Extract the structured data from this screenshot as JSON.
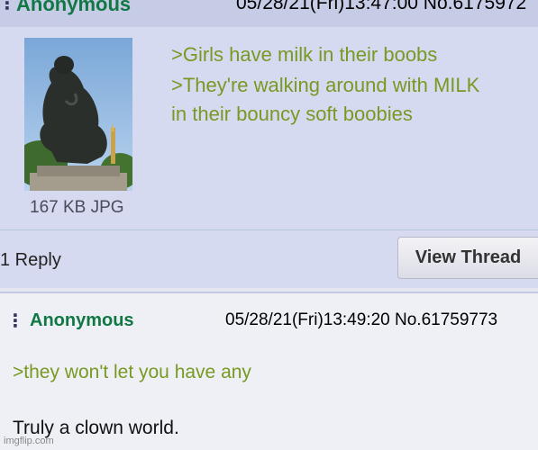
{
  "post1": {
    "dots": "⋮",
    "name": "Anonymous",
    "meta": "05/28/21(Fri)13:47:00 No.6175972",
    "thumbnail_alt": "The Thinker statue",
    "file_info": "167 KB JPG",
    "lines": [
      ">Girls have milk in their boobs",
      ">They're walking around with MILK",
      "in their bouncy soft boobies"
    ],
    "reply_count": "1 Reply",
    "view_thread": "View Thread"
  },
  "post2": {
    "dots": "⋮",
    "name": "Anonymous",
    "meta": "05/28/21(Fri)13:49:20 No.61759773",
    "lines": [
      ">they won't let you have any",
      "Truly a clown world."
    ]
  },
  "watermark": "imgflip.com",
  "colors": {
    "name_green": "#117743",
    "greentext": "#789922",
    "post_bg": "#d6daf0",
    "header_bg": "#c6cbe6"
  }
}
